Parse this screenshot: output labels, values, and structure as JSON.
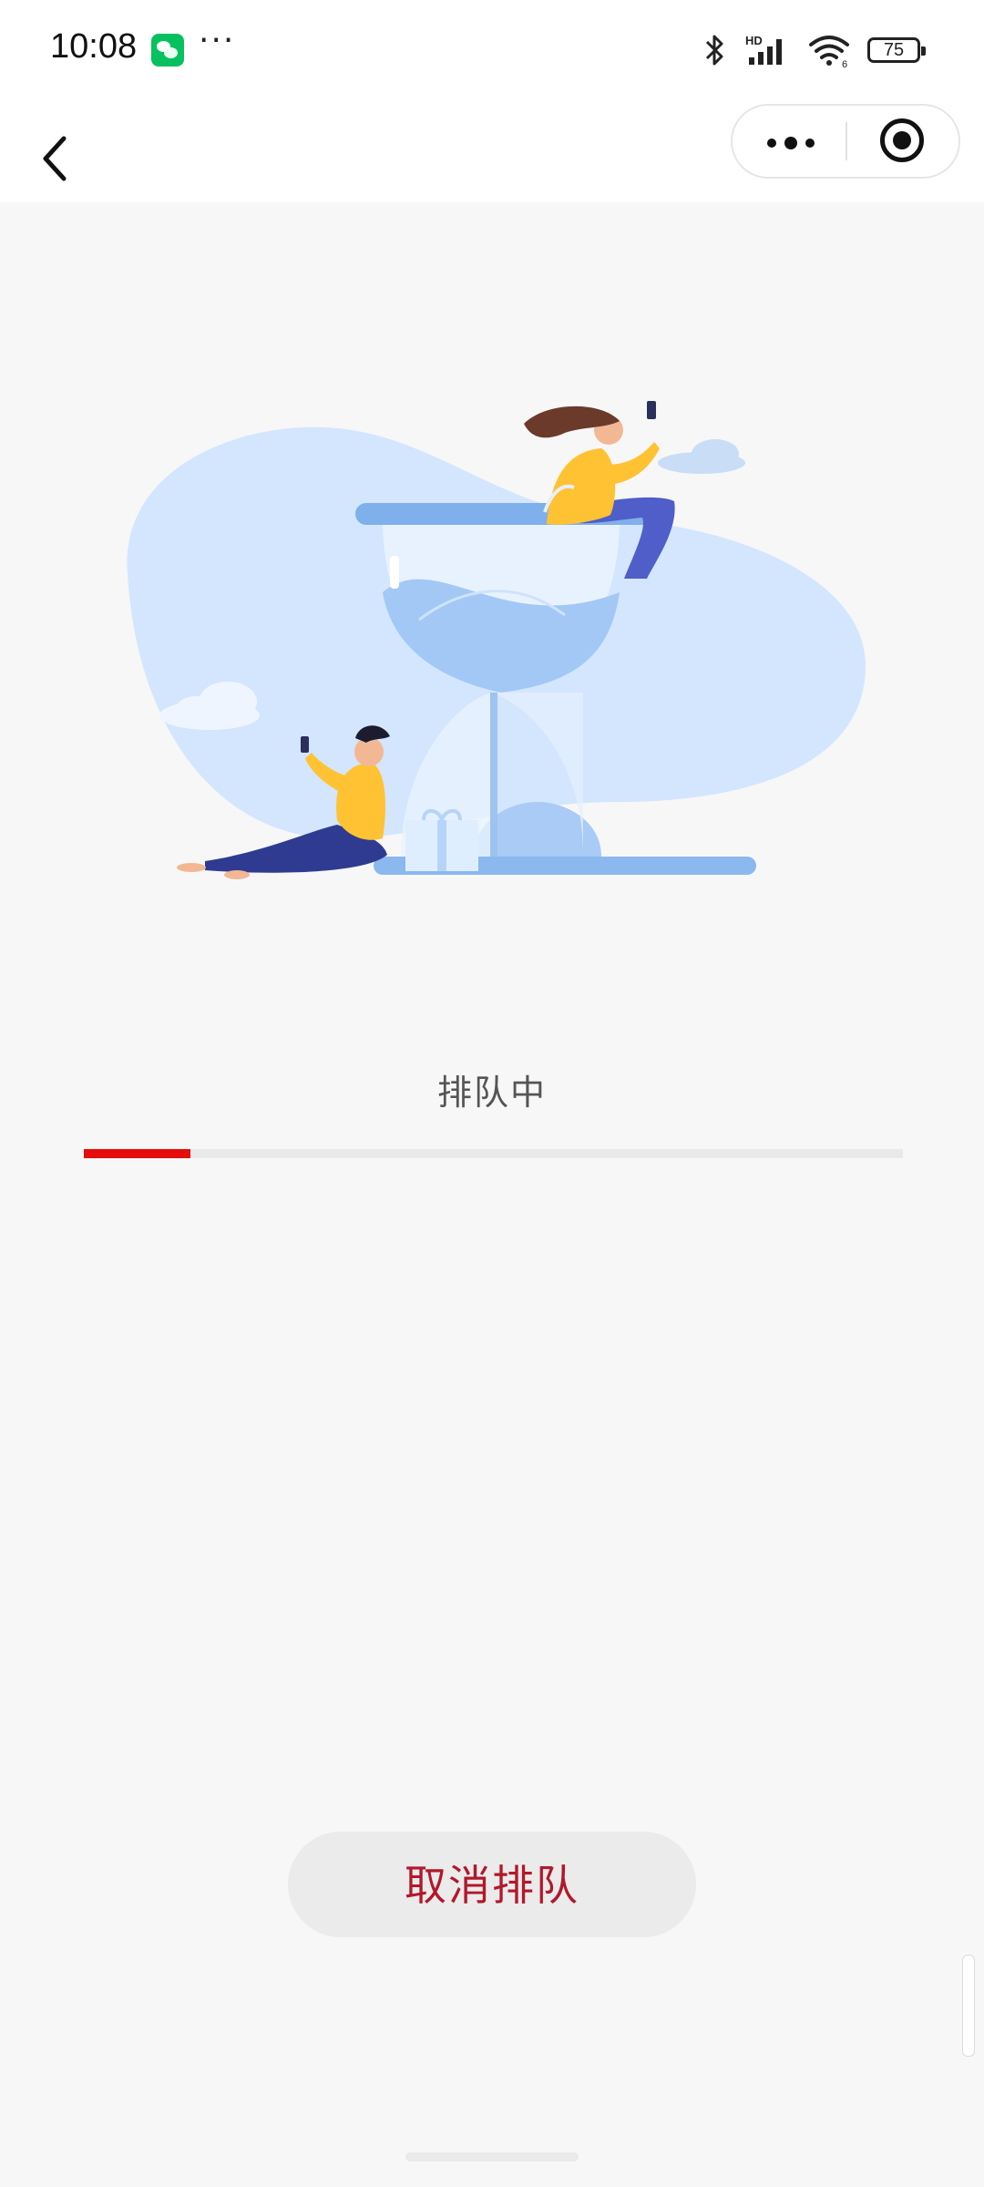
{
  "status_bar": {
    "time": "10:08",
    "app_icon": "wechat-icon",
    "overflow": "···",
    "icons": [
      "bluetooth-icon",
      "signal-hd-icon",
      "wifi-icon"
    ],
    "battery": "75"
  },
  "nav": {
    "back_icon": "chevron-left-icon",
    "more_icon": "more-dots-icon",
    "close_icon": "target-icon"
  },
  "queue": {
    "status": "排队中",
    "progress": 0.13,
    "progress_color": "#e60d0d"
  },
  "actions": {
    "cancel_label": "取消排队",
    "cancel_color": "#b2182b"
  }
}
